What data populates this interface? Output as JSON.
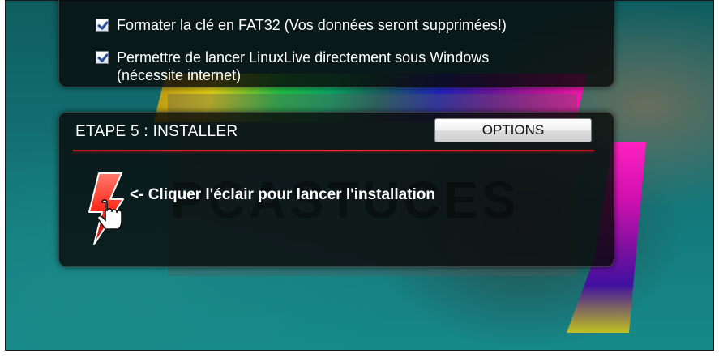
{
  "options": {
    "format_fat32_label": "Formater la clé en FAT32 (Vos données seront supprimées!)",
    "format_fat32_checked": true,
    "launch_windows_label_line1": "Permettre de lancer LinuxLive directement sous Windows",
    "launch_windows_label_line2": "(nécessite internet)",
    "launch_windows_checked": true
  },
  "step5": {
    "title": "ETAPE 5 : INSTALLER",
    "options_button": "OPTIONS",
    "install_hint": "<- Cliquer l'éclair pour lancer l'installation"
  },
  "watermark": "PCASTUCES",
  "colors": {
    "divider": "#e0202a",
    "bolt": "#ff3a2a",
    "panel": "#0a0a0a"
  }
}
